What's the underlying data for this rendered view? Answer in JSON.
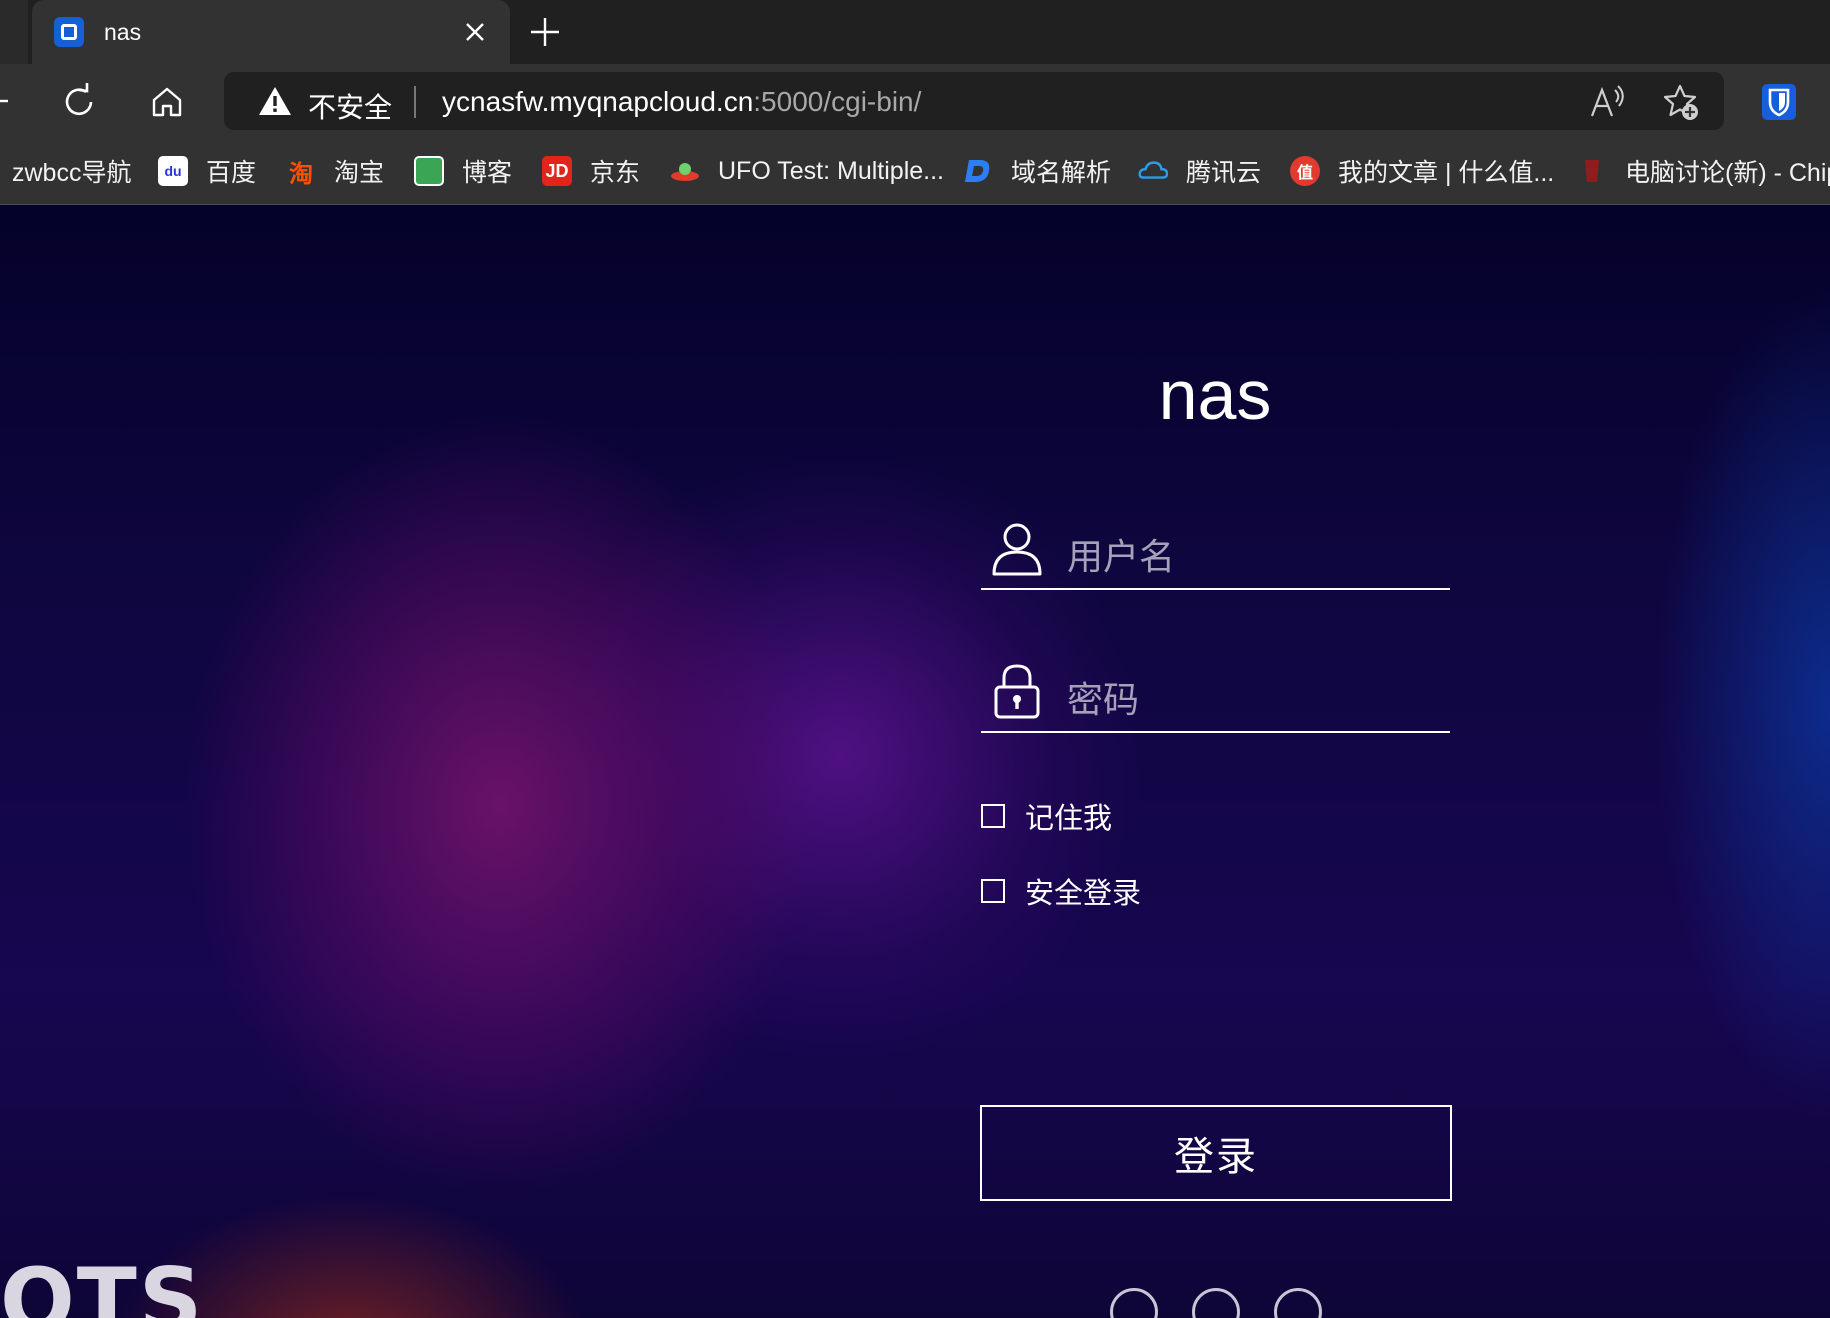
{
  "browser": {
    "tab": {
      "title": "nas",
      "favicon": "qnap-icon"
    },
    "address": {
      "security_label": "不安全",
      "url_host": "ycnasfw.myqnapcloud.cn",
      "url_path": ":5000/cgi-bin/"
    },
    "bookmarks": [
      {
        "label": "zwbcc导航",
        "icon": "none"
      },
      {
        "label": "百度",
        "icon": "baidu-icon"
      },
      {
        "label": "淘宝",
        "icon": "taobao-icon"
      },
      {
        "label": "博客",
        "icon": "blog-icon"
      },
      {
        "label": "京东",
        "icon": "jd-icon"
      },
      {
        "label": "UFO Test: Multiple...",
        "icon": "ufo-icon"
      },
      {
        "label": "域名解析",
        "icon": "dnspod-icon"
      },
      {
        "label": "腾讯云",
        "icon": "tencent-cloud-icon"
      },
      {
        "label": "我的文章 | 什么值...",
        "icon": "smzdm-icon"
      },
      {
        "label": "电脑讨论(新) - Chip",
        "icon": "chiphell-icon"
      }
    ],
    "bookmark_icon_text": {
      "taobao": "淘",
      "jd": "JD",
      "smzdm": "值",
      "baidu": "du"
    }
  },
  "login": {
    "device_name": "nas",
    "username_placeholder": "用户名",
    "password_placeholder": "密码",
    "remember_me": "记住我",
    "secure_login": "安全登录",
    "submit": "登录"
  },
  "footer": {
    "logo_text": "QTS"
  },
  "colors": {
    "accent": "#1560d4",
    "page_top": "#04022a",
    "page_mid": "#170650",
    "placeholder": "#a6a1b8"
  }
}
